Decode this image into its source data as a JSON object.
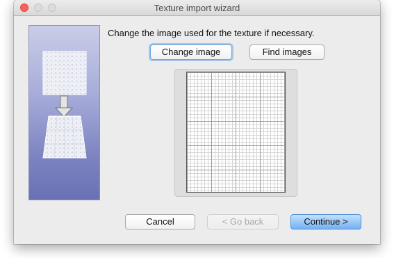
{
  "window": {
    "title": "Texture import wizard"
  },
  "instruction": "Change the image used for the texture if necessary.",
  "buttons": {
    "change_image": "Change image",
    "find_images": "Find images",
    "cancel": "Cancel",
    "go_back": "< Go back",
    "continue": "Continue >"
  },
  "colors": {
    "close": "#fc605c",
    "default_button": "#74b1f2",
    "side_panel_bottom": "#6a71b4"
  },
  "icons": {
    "side_panel": "texture-mapping-illustration",
    "arrow": "arrow-down-icon"
  }
}
